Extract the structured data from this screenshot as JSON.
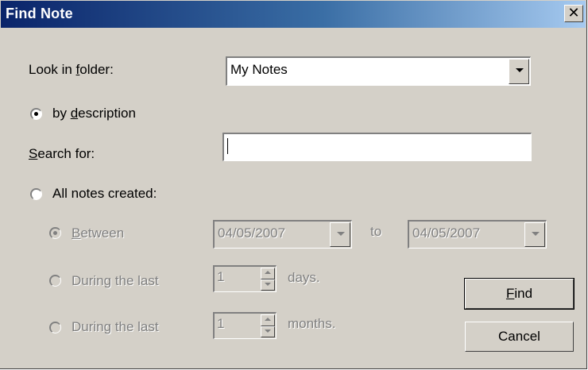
{
  "window": {
    "title": "Find Note",
    "close_glyph": "✕"
  },
  "folder": {
    "label_pre": "Look in ",
    "label_mnemonic": "f",
    "label_post": "older:",
    "value": "My Notes"
  },
  "by_description": {
    "label_pre": "by ",
    "label_mnemonic": "d",
    "label_post": "escription",
    "checked": true
  },
  "search": {
    "label_mnemonic": "S",
    "label_post": "earch for:",
    "value": ""
  },
  "all_notes": {
    "label": "All notes created:",
    "checked": false
  },
  "between": {
    "label_mnemonic": "B",
    "label_post": "etween",
    "from": "04/05/2007",
    "to_label": "to",
    "to": "04/05/2007"
  },
  "last_days": {
    "label": "During the last",
    "value": "1",
    "unit": "days."
  },
  "last_months": {
    "label": "During the last",
    "value": "1",
    "unit": "months."
  },
  "buttons": {
    "find_mnemonic": "F",
    "find_post": "ind",
    "cancel": "Cancel"
  },
  "colors": {
    "face": "#d4d0c8",
    "title_start": "#0a246a",
    "title_end": "#a6caf0",
    "disabled_text": "#808080"
  }
}
